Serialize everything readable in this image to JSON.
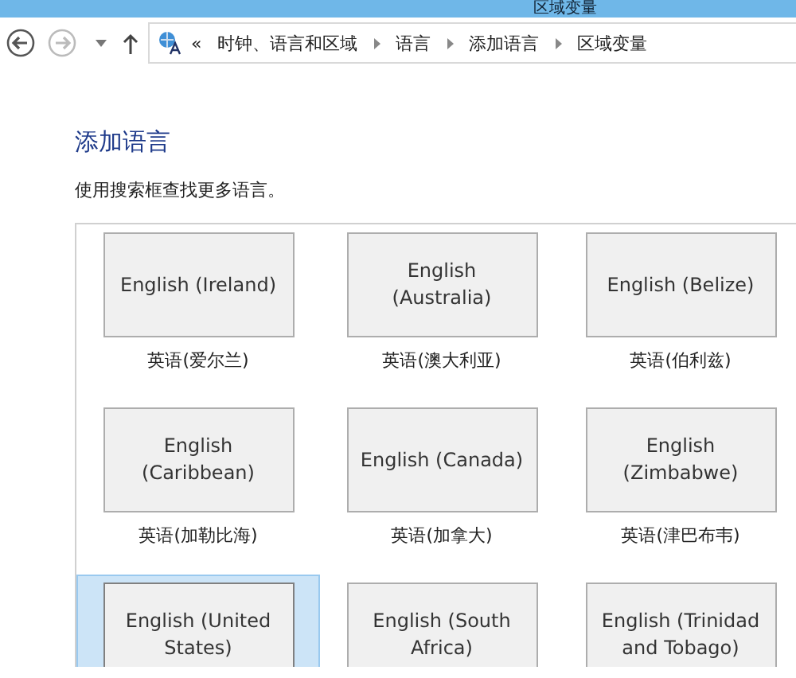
{
  "window": {
    "title": "区域变量"
  },
  "address_bar": {
    "overflow": "«",
    "path": [
      "时钟、语言和区域",
      "语言",
      "添加语言",
      "区域变量"
    ]
  },
  "heading": "添加语言",
  "instruction": "使用搜索框查找更多语言。",
  "languages": [
    {
      "button": "English (Ireland)",
      "label": "英语(爱尔兰)",
      "selected": false
    },
    {
      "button": "English (Australia)",
      "label": "英语(澳大利亚)",
      "selected": false
    },
    {
      "button": "English (Belize)",
      "label": "英语(伯利兹)",
      "selected": false
    },
    {
      "button": "English (Caribbean)",
      "label": "英语(加勒比海)",
      "selected": false
    },
    {
      "button": "English (Canada)",
      "label": "英语(加拿大)",
      "selected": false
    },
    {
      "button": "English (Zimbabwe)",
      "label": "英语(津巴布韦)",
      "selected": false
    },
    {
      "button": "English (United States)",
      "selected": true
    },
    {
      "button": "English (South Africa)",
      "selected": false
    },
    {
      "button": "English (Trinidad and Tobago)",
      "selected": false
    }
  ]
}
